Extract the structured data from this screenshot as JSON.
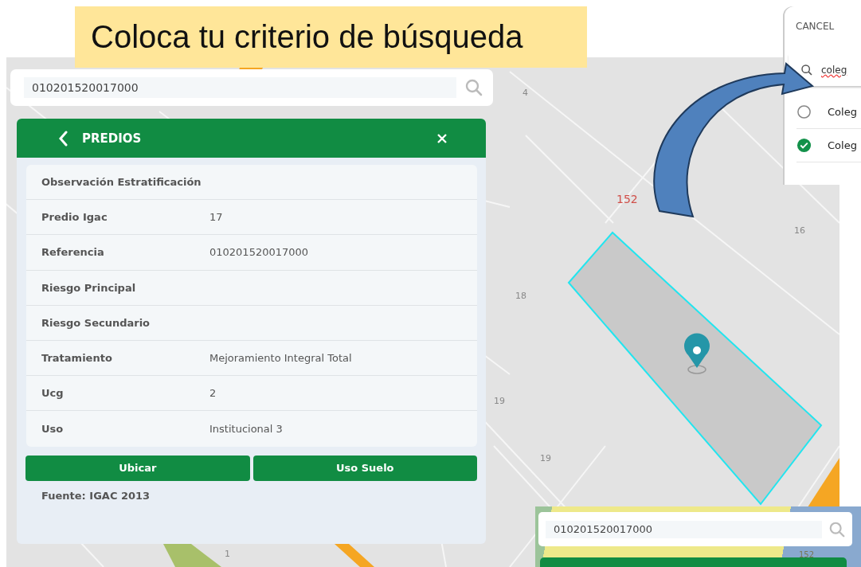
{
  "slide_title": "Coloca tu criterio de búsqueda",
  "map": {
    "lot_labels": [
      {
        "text": "4",
        "kind": "lot"
      },
      {
        "text": "152",
        "kind": "block"
      },
      {
        "text": "16",
        "kind": "lot"
      },
      {
        "text": "18",
        "kind": "lot"
      },
      {
        "text": "19",
        "kind": "lot"
      },
      {
        "text": "19",
        "kind": "lot"
      },
      {
        "text": "1",
        "kind": "lot"
      }
    ]
  },
  "search": {
    "value": "010201520017000"
  },
  "panel": {
    "title": "PREDIOS",
    "rows": [
      {
        "label": "Observación Estratificación"
      },
      {
        "label": "Predio Igac",
        "value": "17"
      },
      {
        "label": "Referencia",
        "value": "010201520017000"
      },
      {
        "label": "Riesgo Principal"
      },
      {
        "label": "Riesgo Secundario"
      },
      {
        "label": "Tratamiento",
        "value": "Mejoramiento Integral Total"
      },
      {
        "label": "Ucg",
        "value": "2"
      },
      {
        "label": "Uso",
        "value": "Institucional 3"
      }
    ],
    "buttons": [
      "Ubicar",
      "Uso Suelo"
    ],
    "source": "Fuente: IGAC 2013"
  },
  "search_dialog": {
    "cancel": "CANCEL",
    "query": "coleg",
    "results": [
      {
        "label": "Coleg",
        "selected": false
      },
      {
        "label": "Coleg",
        "selected": true
      }
    ]
  },
  "inset": {
    "search": {
      "value": "010201520017000"
    },
    "lot_label": "152"
  }
}
